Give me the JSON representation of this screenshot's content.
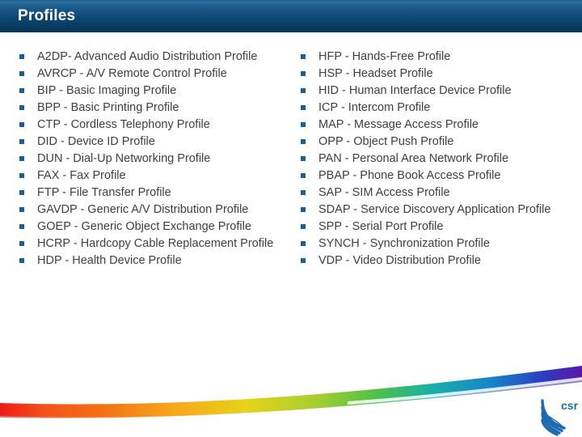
{
  "header": {
    "title": "Profiles",
    "bg_top_color": "#2e6e9e",
    "bg_bottom_color": "#04344f",
    "title_color": "#ffffff"
  },
  "content": {
    "bullet_color": "#1c5f90",
    "text_color": "#3f3f3f",
    "left_column": [
      "A2DP- Advanced Audio Distribution Profile",
      "AVRCP - A/V Remote Control Profile",
      "BIP - Basic Imaging Profile",
      "BPP - Basic Printing Profile",
      "CTP - Cordless Telephony Profile",
      "DID - Device ID Profile",
      "DUN - Dial-Up Networking Profile",
      "FAX - Fax Profile",
      "FTP - File Transfer Profile",
      "GAVDP - Generic A/V Distribution Profile",
      "GOEP - Generic Object Exchange Profile",
      "HCRP - Hardcopy Cable Replacement Profile",
      "HDP - Health Device Profile"
    ],
    "right_column": [
      "HFP - Hands-Free Profile",
      "HSP - Headset Profile",
      "HID - Human Interface Device Profile",
      "ICP - Intercom Profile",
      "MAP - Message Access Profile",
      "OPP - Object Push Profile",
      "PAN - Personal Area Network Profile",
      "PBAP - Phone Book Access Profile",
      "SAP - SIM Access Profile",
      "SDAP - Service Discovery Application Profile",
      "SPP - Serial Port Profile",
      "SYNCH - Synchronization Profile",
      "VDP - Video Distribution Profile"
    ]
  },
  "footer": {
    "swoosh_colors": [
      "#ee1c16",
      "#f47216",
      "#f7a81b",
      "#e8d21a",
      "#a8cf2e",
      "#4cc04a",
      "#19b0a8",
      "#1787c8",
      "#2b3fc0",
      "#5a17a8"
    ],
    "logo_name": "csr",
    "logo_color": "#1c6bb0"
  }
}
